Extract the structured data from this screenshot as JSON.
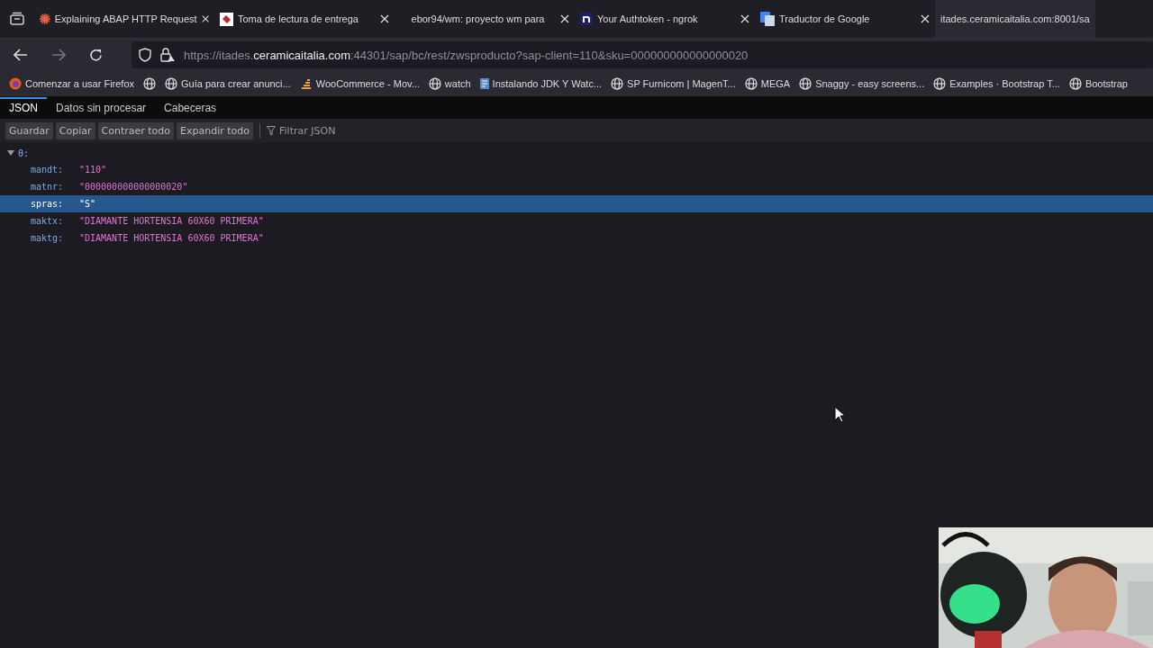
{
  "tabs": [
    {
      "title": "Explaining ABAP HTTP Request",
      "selected": false,
      "closable": true
    },
    {
      "title": "Toma de lectura de entrega",
      "selected": false,
      "closable": true
    },
    {
      "title": "ebor94/wm: proyecto wm para",
      "selected": false,
      "closable": true
    },
    {
      "title": "Your Authtoken - ngrok",
      "selected": false,
      "closable": true
    },
    {
      "title": "Traductor de Google",
      "selected": false,
      "closable": true
    },
    {
      "title": "itades.ceramicaitalia.com:8001/sa",
      "selected": true,
      "closable": false
    }
  ],
  "url": {
    "prefix": "https://itades.",
    "domain": "ceramicaitalia.com",
    "rest": ":44301/sap/bc/rest/zwsproducto?sap-client=110&sku=000000000000000020"
  },
  "bookmarks": [
    {
      "label": "Comenzar a usar Firefox"
    },
    {
      "kind": "icon_only"
    },
    {
      "label": "Guía para crear anunci..."
    },
    {
      "label": "WooCommerce - Mov..."
    },
    {
      "label": "watch"
    },
    {
      "label": "Instalando JDK Y Watc..."
    },
    {
      "label": "SP Furnicom | MagenT..."
    },
    {
      "label": "MEGA"
    },
    {
      "label": "Snaggy - easy screens..."
    },
    {
      "label": "Examples · Bootstrap T..."
    },
    {
      "label": "Bootstrap"
    }
  ],
  "viewer_tabs": [
    {
      "label": "JSON",
      "selected": true
    },
    {
      "label": "Datos sin procesar",
      "selected": false
    },
    {
      "label": "Cabeceras",
      "selected": false
    }
  ],
  "toolbar": {
    "buttons": [
      "Guardar",
      "Copiar",
      "Contraer todo",
      "Expandir todo"
    ],
    "filter_placeholder": "Filtrar JSON"
  },
  "tree": {
    "key": "0:",
    "expanded": true,
    "children": [
      {
        "key": "mandt:",
        "value": "\"110\"",
        "selected": false
      },
      {
        "key": "matnr:",
        "value": "\"000000000000000020\"",
        "selected": false
      },
      {
        "key": "spras:",
        "value": "\"S\"",
        "selected": true
      },
      {
        "key": "maktx:",
        "value": "\"DIAMANTE HORTENSIA 60X60 PRIMERA\"",
        "selected": false
      },
      {
        "key": "maktg:",
        "value": "\"DIAMANTE HORTENSIA 60X60 PRIMERA\"",
        "selected": false
      }
    ]
  }
}
